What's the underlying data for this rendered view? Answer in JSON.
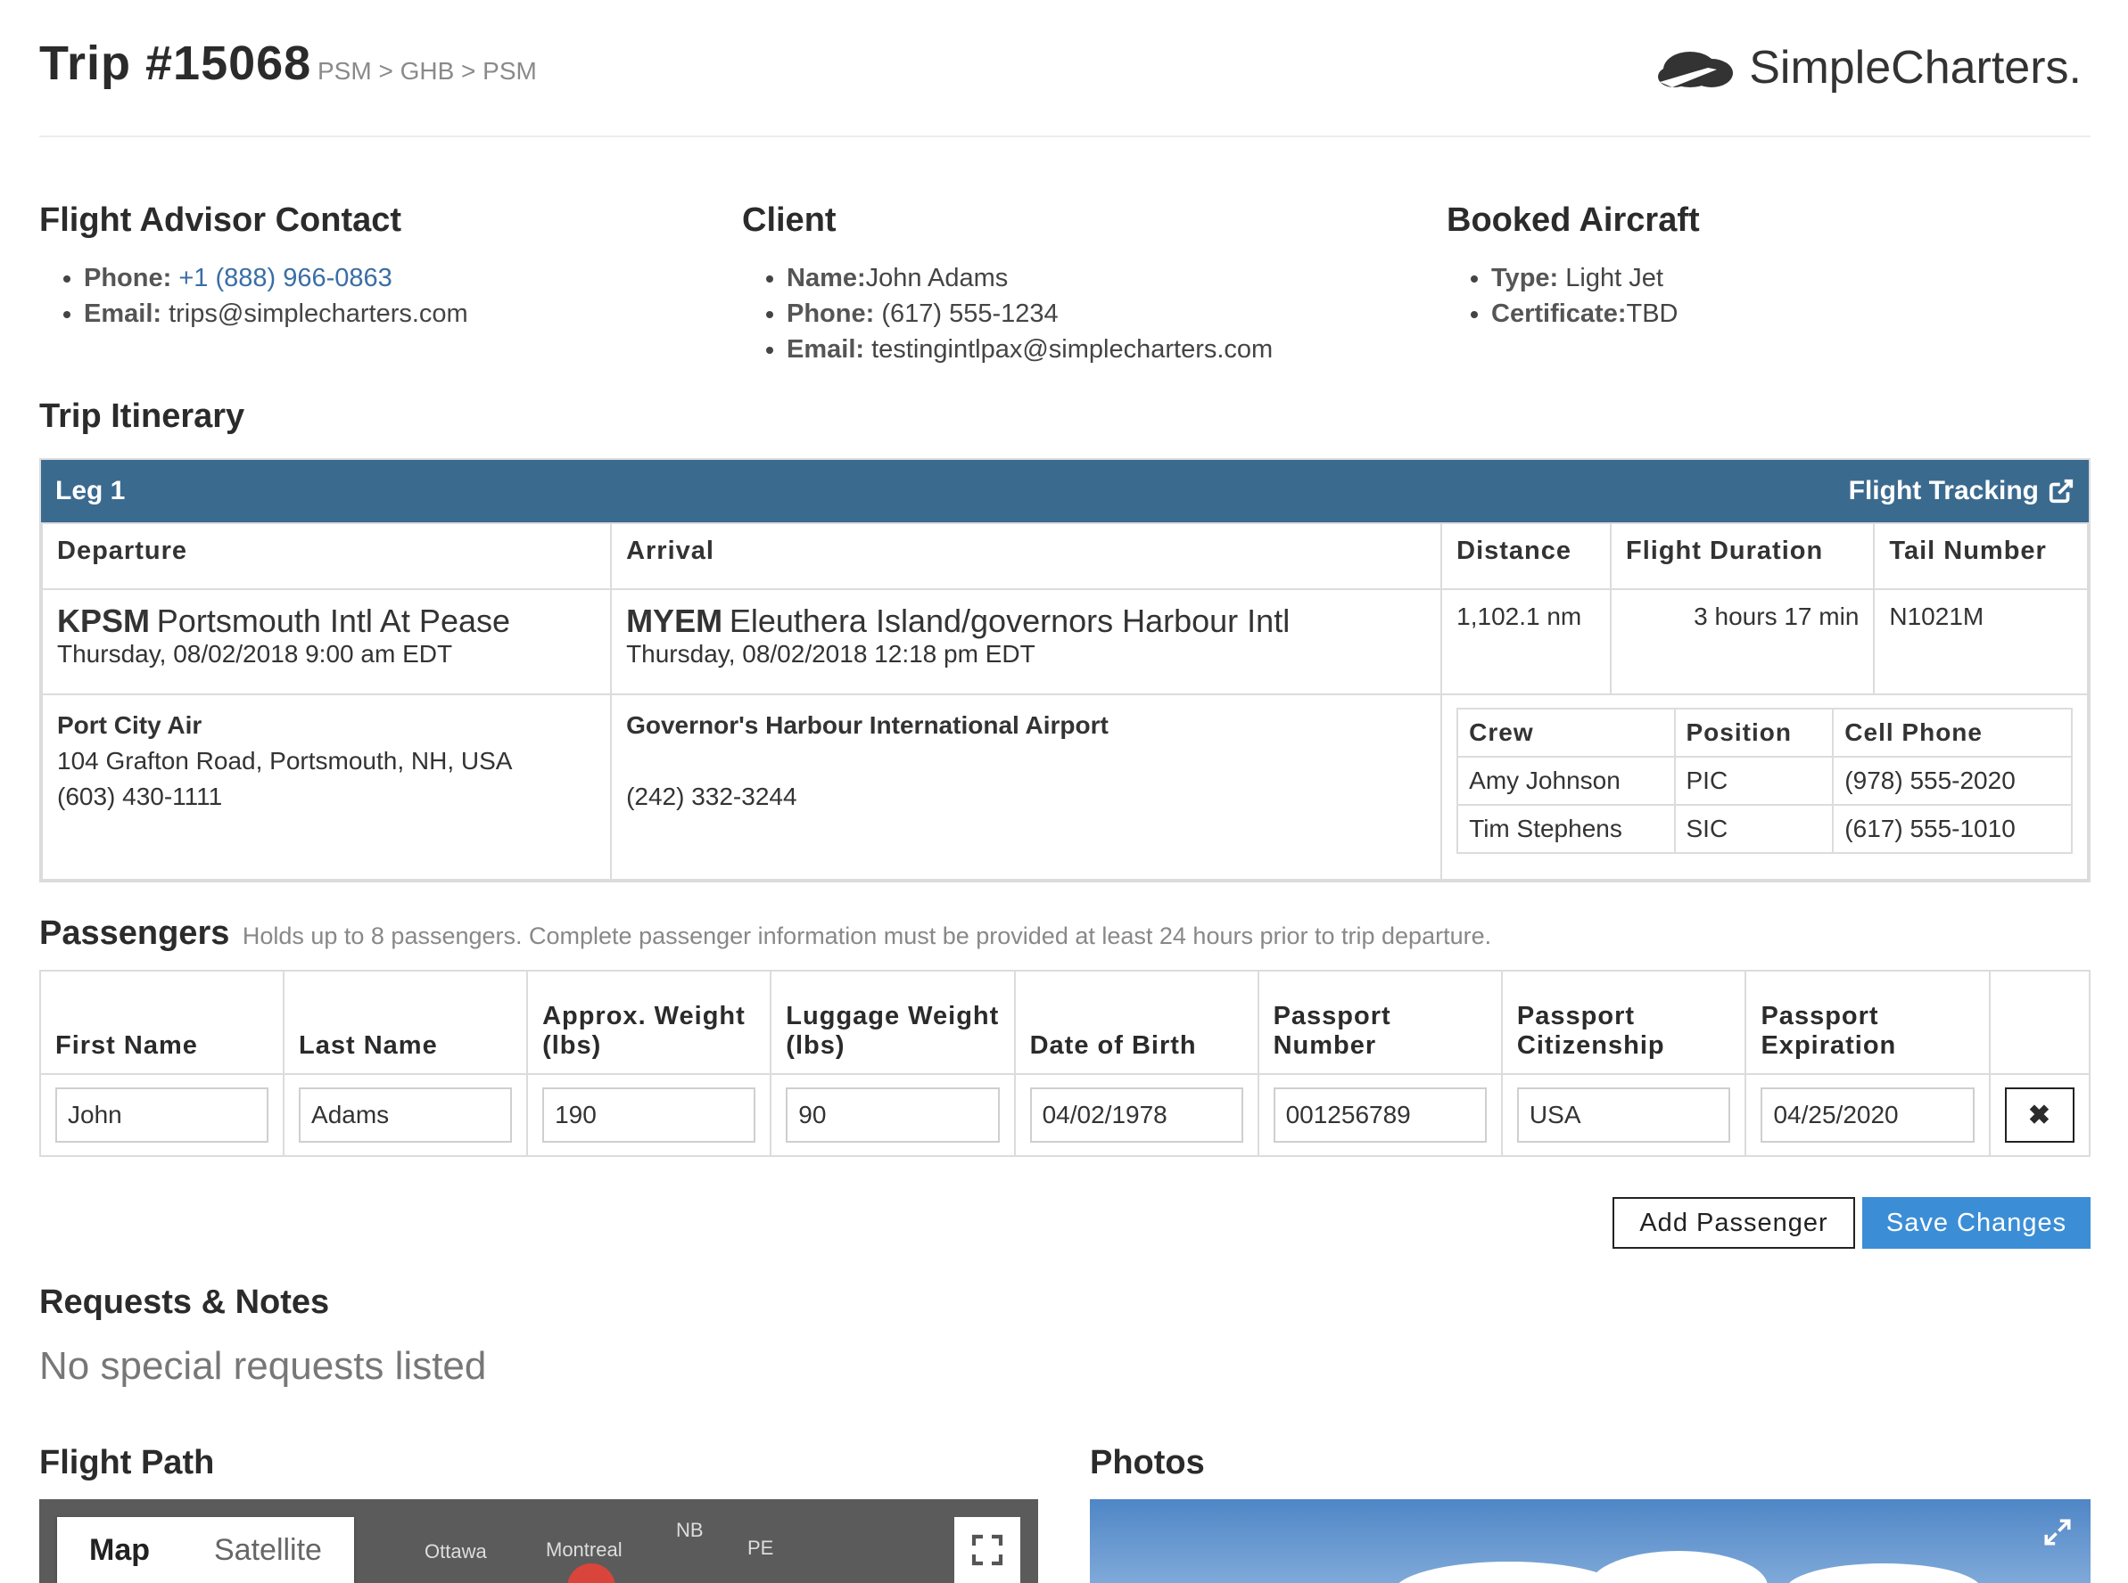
{
  "header": {
    "trip_title": "Trip #15068",
    "route": "PSM > GHB > PSM",
    "logo_text": "SimpleCharters."
  },
  "advisor": {
    "heading": "Flight Advisor Contact",
    "phone_label": "Phone:",
    "phone": "+1 (888) 966-0863",
    "email_label": "Email:",
    "email": "trips@simplecharters.com"
  },
  "client": {
    "heading": "Client",
    "name_label": "Name:",
    "name": "John Adams",
    "phone_label": "Phone:",
    "phone": "(617) 555-1234",
    "email_label": "Email:",
    "email": "testingintlpax@simplecharters.com"
  },
  "aircraft": {
    "heading": "Booked Aircraft",
    "type_label": "Type:",
    "type": "Light Jet",
    "cert_label": "Certificate:",
    "cert": "TBD"
  },
  "itinerary": {
    "heading": "Trip Itinerary",
    "leg_title": "Leg 1",
    "tracking_label": "Flight Tracking",
    "columns": [
      "Departure",
      "Arrival",
      "Distance",
      "Flight Duration",
      "Tail Number"
    ],
    "departure": {
      "code": "KPSM",
      "airport": "Portsmouth Intl At Pease",
      "time": "Thursday, 08/02/2018 9:00 am EDT",
      "fbo": "Port City Air",
      "address": "104 Grafton Road, Portsmouth, NH, USA",
      "phone": "(603) 430-1111"
    },
    "arrival": {
      "code": "MYEM",
      "airport": "Eleuthera Island/governors Harbour Intl",
      "time": "Thursday, 08/02/2018 12:18 pm EDT",
      "fbo": "Governor's Harbour International Airport",
      "phone": "(242) 332-3244"
    },
    "distance": "1,102.1 nm",
    "duration": "3 hours 17 min",
    "tail_number": "N1021M",
    "crew_columns": [
      "Crew",
      "Position",
      "Cell Phone"
    ],
    "crew": [
      {
        "name": "Amy Johnson",
        "position": "PIC",
        "phone": "(978) 555-2020"
      },
      {
        "name": "Tim Stephens",
        "position": "SIC",
        "phone": "(617) 555-1010"
      }
    ]
  },
  "passengers": {
    "heading": "Passengers",
    "note": "Holds up to 8 passengers. Complete passenger information must be provided at least 24 hours prior to trip departure.",
    "columns": [
      "First Name",
      "Last Name",
      "Approx. Weight (lbs)",
      "Luggage Weight (lbs)",
      "Date of Birth",
      "Passport Number",
      "Passport Citizenship",
      "Passport Expiration"
    ],
    "rows": [
      {
        "first": "John",
        "last": "Adams",
        "weight": "190",
        "luggage": "90",
        "dob": "04/02/1978",
        "passport": "001256789",
        "citizenship": "USA",
        "expiration": "04/25/2020"
      }
    ],
    "remove_label": "✖",
    "add_label": "Add Passenger",
    "save_label": "Save Changes"
  },
  "requests": {
    "heading": "Requests & Notes",
    "empty_text": "No special requests listed"
  },
  "flight_path": {
    "heading": "Flight Path",
    "map_tab": "Map",
    "satellite_tab": "Satellite",
    "labels": [
      "Ottawa",
      "Montreal",
      "NB",
      "PE"
    ]
  },
  "photos": {
    "heading": "Photos"
  },
  "colors": {
    "leg_bar": "#3b6a8f",
    "link": "#3a6ea5",
    "save_button": "#3b8ed6"
  }
}
